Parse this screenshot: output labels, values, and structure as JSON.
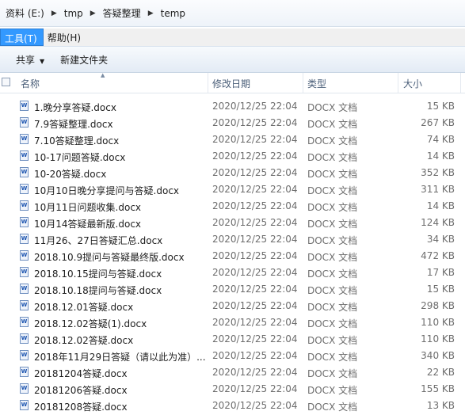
{
  "address": {
    "crumbs": [
      "资料 (E:)",
      "tmp",
      "答疑整理",
      "temp"
    ]
  },
  "menu": {
    "items": [
      "工具(T)",
      "帮助(H)"
    ]
  },
  "toolbar": {
    "share_label": "共享",
    "new_folder_label": "新建文件夹"
  },
  "columns": {
    "name": "名称",
    "date": "修改日期",
    "type": "类型",
    "size": "大小"
  },
  "files": [
    {
      "name": "1.晚分享答疑.docx",
      "date": "2020/12/25 22:04",
      "type": "DOCX 文档",
      "size": "15 KB"
    },
    {
      "name": "7.9答疑整理.docx",
      "date": "2020/12/25 22:04",
      "type": "DOCX 文档",
      "size": "267 KB"
    },
    {
      "name": "7.10答疑整理.docx",
      "date": "2020/12/25 22:04",
      "type": "DOCX 文档",
      "size": "74 KB"
    },
    {
      "name": "10-17问题答疑.docx",
      "date": "2020/12/25 22:04",
      "type": "DOCX 文档",
      "size": "14 KB"
    },
    {
      "name": "10-20答疑.docx",
      "date": "2020/12/25 22:04",
      "type": "DOCX 文档",
      "size": "352 KB"
    },
    {
      "name": "10月10日晚分享提问与答疑.docx",
      "date": "2020/12/25 22:04",
      "type": "DOCX 文档",
      "size": "311 KB"
    },
    {
      "name": "10月11日问题收集.docx",
      "date": "2020/12/25 22:04",
      "type": "DOCX 文档",
      "size": "14 KB"
    },
    {
      "name": "10月14答疑最新版.docx",
      "date": "2020/12/25 22:04",
      "type": "DOCX 文档",
      "size": "124 KB"
    },
    {
      "name": "11月26、27日答疑汇总.docx",
      "date": "2020/12/25 22:04",
      "type": "DOCX 文档",
      "size": "34 KB"
    },
    {
      "name": "2018.10.9提问与答疑最终版.docx",
      "date": "2020/12/25 22:04",
      "type": "DOCX 文档",
      "size": "472 KB"
    },
    {
      "name": "2018.10.15提问与答疑.docx",
      "date": "2020/12/25 22:04",
      "type": "DOCX 文档",
      "size": "17 KB"
    },
    {
      "name": "2018.10.18提问与答疑.docx",
      "date": "2020/12/25 22:04",
      "type": "DOCX 文档",
      "size": "15 KB"
    },
    {
      "name": "2018.12.01答疑.docx",
      "date": "2020/12/25 22:04",
      "type": "DOCX 文档",
      "size": "298 KB"
    },
    {
      "name": "2018.12.02答疑(1).docx",
      "date": "2020/12/25 22:04",
      "type": "DOCX 文档",
      "size": "110 KB"
    },
    {
      "name": "2018.12.02答疑.docx",
      "date": "2020/12/25 22:04",
      "type": "DOCX 文档",
      "size": "110 KB"
    },
    {
      "name": "2018年11月29日答疑（请以此为准）...",
      "date": "2020/12/25 22:04",
      "type": "DOCX 文档",
      "size": "340 KB"
    },
    {
      "name": "20181204答疑.docx",
      "date": "2020/12/25 22:04",
      "type": "DOCX 文档",
      "size": "22 KB"
    },
    {
      "name": "20181206答疑.docx",
      "date": "2020/12/25 22:04",
      "type": "DOCX 文档",
      "size": "155 KB"
    },
    {
      "name": "20181208答疑.docx",
      "date": "2020/12/25 22:04",
      "type": "DOCX 文档",
      "size": "13 KB"
    }
  ],
  "file_icon": "word-document-icon"
}
